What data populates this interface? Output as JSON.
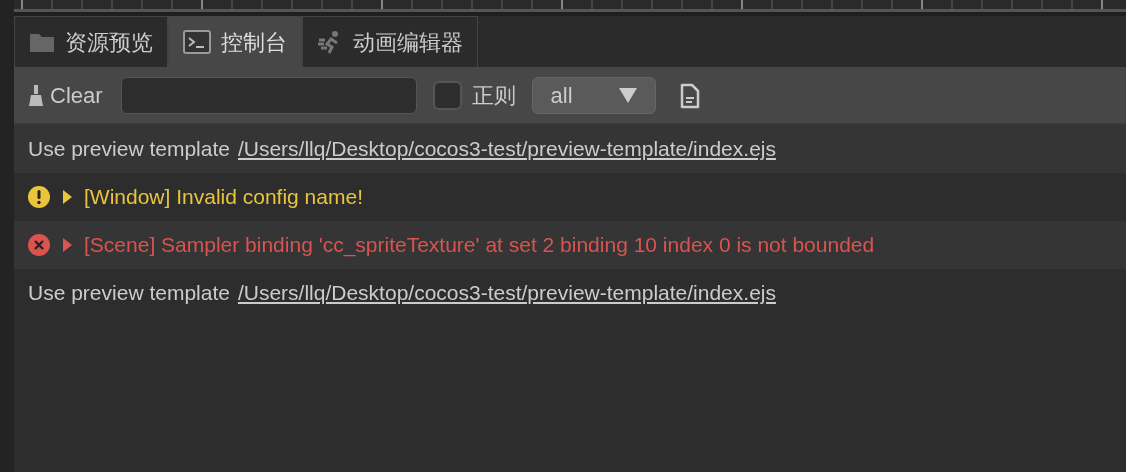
{
  "tabs": [
    {
      "label": "资源预览",
      "kind": "folder",
      "selected": false
    },
    {
      "label": "控制台",
      "kind": "terminal",
      "selected": true
    },
    {
      "label": "动画编辑器",
      "kind": "runner",
      "selected": false
    }
  ],
  "toolbar": {
    "clear_button": "Clear",
    "regex": {
      "label": "正则",
      "checked": false
    },
    "level_select": {
      "value": "all"
    }
  },
  "logs": [
    {
      "kind": "log",
      "text": "Use preview template",
      "link": "/Users/llq/Desktop/cocos3-test/preview-template/index.ejs"
    },
    {
      "kind": "warn",
      "text": "[Window] Invalid config name!",
      "expanded": false
    },
    {
      "kind": "error",
      "text": "[Scene] Sampler binding 'cc_spriteTexture' at set 2 binding 10 index 0 is not bounded",
      "expanded": false
    },
    {
      "kind": "log",
      "text": "Use preview template",
      "link": "/Users/llq/Desktop/cocos3-test/preview-template/index.ejs"
    }
  ]
}
